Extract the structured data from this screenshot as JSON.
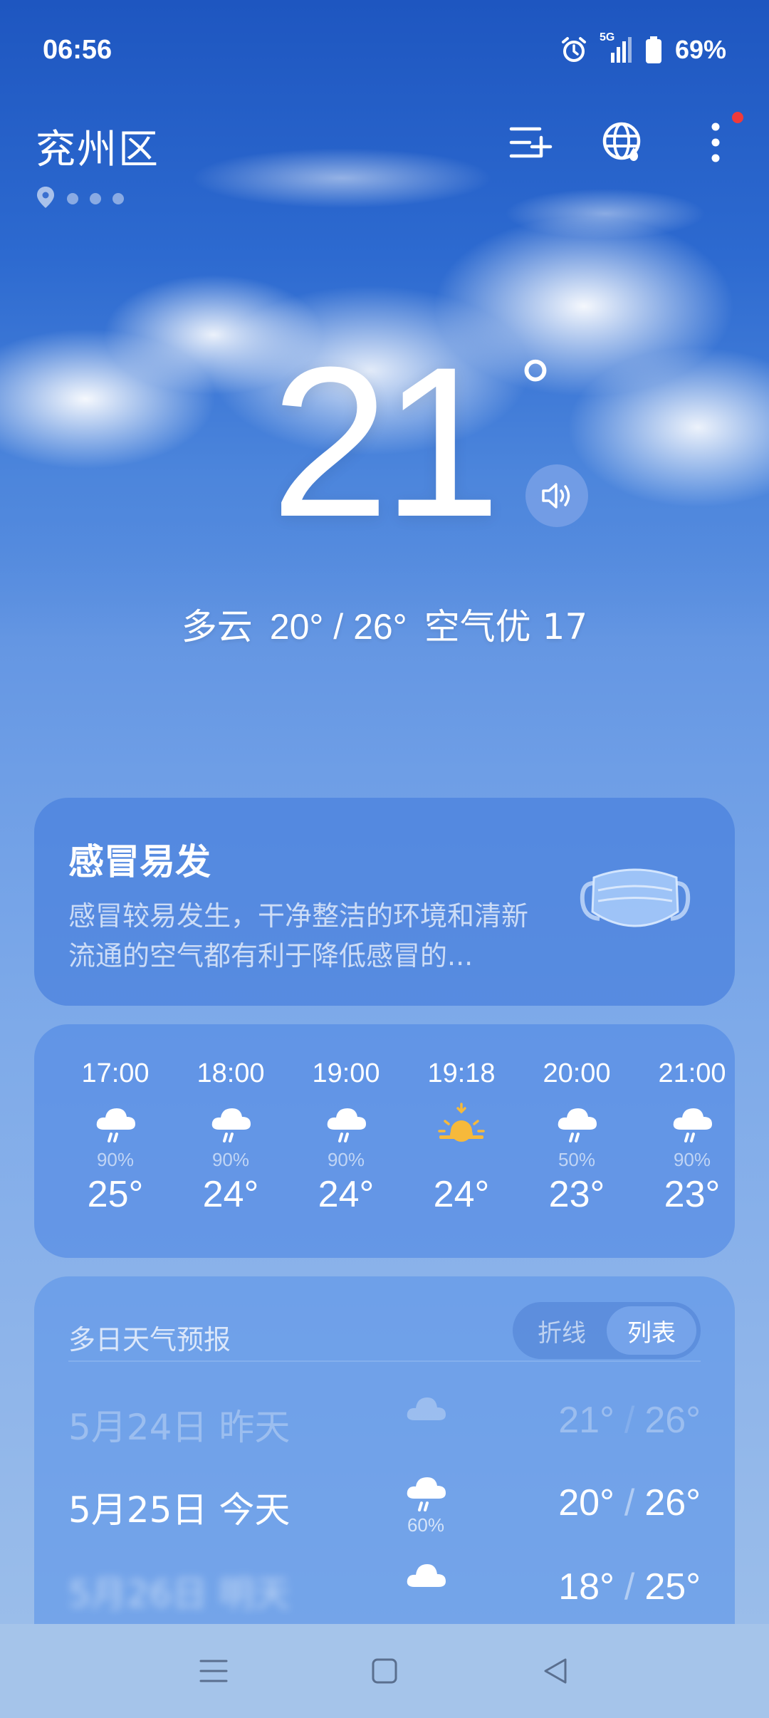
{
  "status_bar": {
    "time": "06:56",
    "network": "5G",
    "battery": "69%"
  },
  "header": {
    "city": "兖州区",
    "icons": [
      "add-city-icon",
      "globe-icon",
      "more-options-icon"
    ]
  },
  "current": {
    "temperature": "21",
    "degree_symbol": "°",
    "condition": "多云",
    "range": "20° / 26°",
    "air_quality": "空气优 17"
  },
  "health_card": {
    "title": "感冒易发",
    "description": "感冒较易发生，干净整洁的环境和清新流通的空气都有利于降低感冒的..."
  },
  "hourly": [
    {
      "time": "17:00",
      "icon": "rain-cloud-icon",
      "pct": "90%",
      "temp": "25°"
    },
    {
      "time": "18:00",
      "icon": "rain-cloud-icon",
      "pct": "90%",
      "temp": "24°"
    },
    {
      "time": "19:00",
      "icon": "rain-cloud-icon",
      "pct": "90%",
      "temp": "24°"
    },
    {
      "time": "19:18",
      "icon": "sunset-icon",
      "pct": "",
      "temp": "24°"
    },
    {
      "time": "20:00",
      "icon": "rain-cloud-icon",
      "pct": "50%",
      "temp": "23°"
    },
    {
      "time": "21:00",
      "icon": "rain-cloud-icon",
      "pct": "90%",
      "temp": "23°"
    }
  ],
  "daily": {
    "title": "多日天气预报",
    "toggle": {
      "line": "折线",
      "list": "列表"
    },
    "rows": [
      {
        "label": "5月24日  昨天",
        "icon": "cloud-icon",
        "pct": "",
        "low": "21°",
        "high": "26°"
      },
      {
        "label": "5月25日  今天",
        "icon": "rain-cloud-icon",
        "pct": "60%",
        "low": "20°",
        "high": "26°"
      },
      {
        "label": "5月26日  明天",
        "icon": "cloud-icon",
        "pct": "",
        "low": "18°",
        "high": "25°"
      }
    ],
    "slash": "/"
  },
  "colors": {
    "alert_dot": "#f03a3a",
    "sun": "#f6b93b"
  }
}
